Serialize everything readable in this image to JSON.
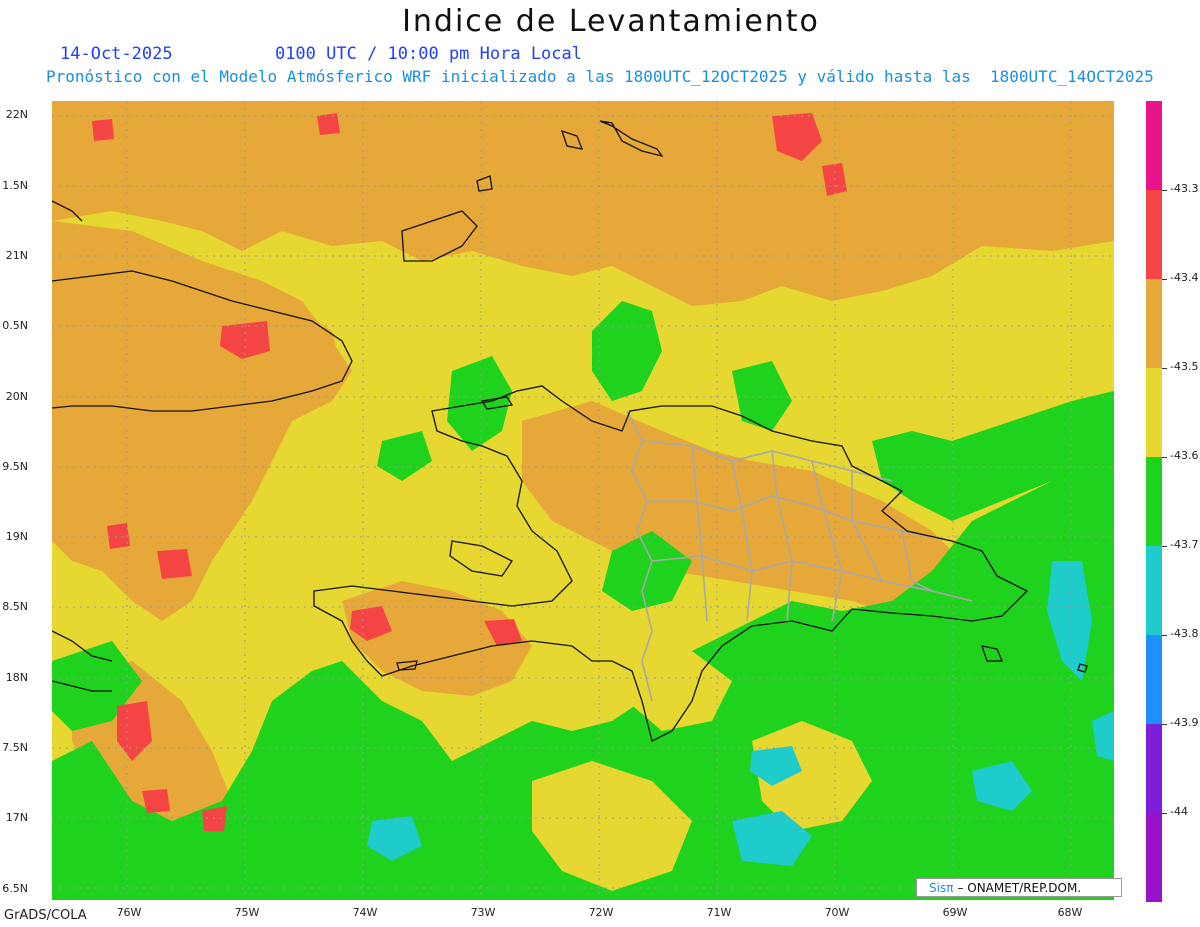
{
  "title": "Indice de Levantamiento",
  "date": "14-Oct-2025",
  "time": "0100 UTC / 10:00 pm Hora Local",
  "model_line": "Pronóstico con el Modelo Atmósferico WRF inicializado a las 1800UTC_12OCT2025 y válido hasta las  1800UTC_14OCT2025",
  "lat_labels": [
    "22N",
    "1.5N",
    "21N",
    "0.5N",
    "20N",
    "9.5N",
    "19N",
    "8.5N",
    "18N",
    "7.5N",
    "17N",
    "6.5N"
  ],
  "lon_labels": [
    "76W",
    "75W",
    "74W",
    "73W",
    "72W",
    "71W",
    "70W",
    "69W",
    "68W"
  ],
  "colorbar": {
    "labels": [
      "-43.3",
      "-43.4",
      "-43.5",
      "-43.6",
      "-43.7",
      "-43.8",
      "-43.9",
      "-44"
    ],
    "colors": [
      "#e8148c",
      "#f44444",
      "#e6a838",
      "#e6d830",
      "#1ed21e",
      "#1ecccc",
      "#1e90ff",
      "#7e1edc",
      "#9a12c8"
    ]
  },
  "palette": {
    "orange": "#e6a838",
    "yellow": "#e6d830",
    "green": "#1ed21e",
    "cyan": "#1ecccc",
    "red": "#f44444",
    "border_gray": "#a8a8a8",
    "coast": "#111111"
  },
  "credit": {
    "brand": "Sisπ",
    "text": "– ONAMET/REP.DOM."
  },
  "footer": "GrADS/COLA"
}
